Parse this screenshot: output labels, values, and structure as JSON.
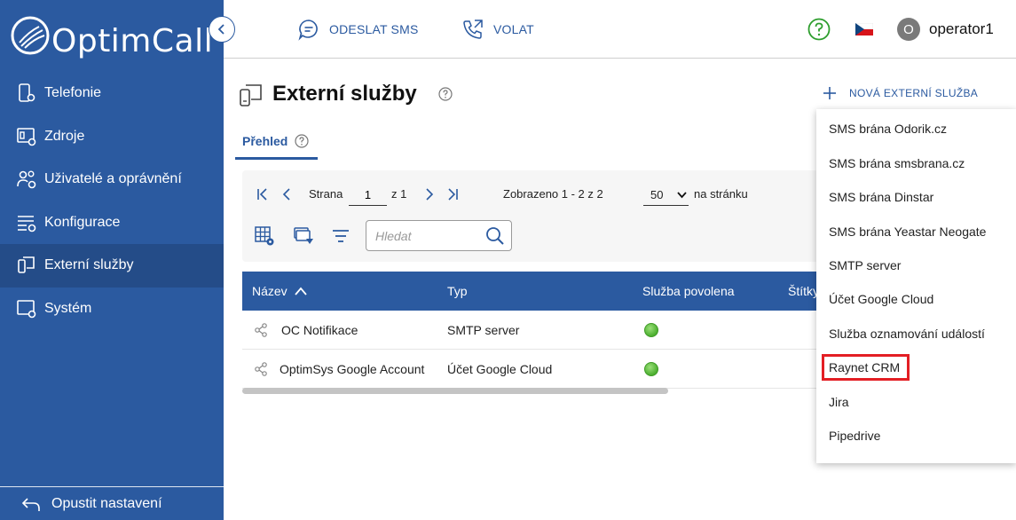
{
  "app": {
    "name": "OptimCall"
  },
  "sidebar": {
    "items": [
      {
        "label": "Telefonie",
        "icon": "phone-gear-icon"
      },
      {
        "label": "Zdroje",
        "icon": "resources-gear-icon"
      },
      {
        "label": "Uživatelé a oprávnění",
        "icon": "users-gear-icon"
      },
      {
        "label": "Konfigurace",
        "icon": "config-gear-icon"
      },
      {
        "label": "Externí služby",
        "icon": "external-services-icon"
      },
      {
        "label": "Systém",
        "icon": "system-gear-icon"
      }
    ],
    "active_index": 4,
    "bottom_label": "Opustit nastavení"
  },
  "topbar": {
    "send_sms": "ODESLAT SMS",
    "call": "VOLAT",
    "username": "operator1",
    "avatar_letter": "O"
  },
  "page": {
    "title": "Externí služby",
    "new_service_label": "NOVÁ EXTERNÍ SLUŽBA",
    "tab_label": "Přehled"
  },
  "pager": {
    "page_label": "Strana",
    "current_page": "1",
    "of_label": "z 1",
    "shown_label": "Zobrazeno 1 - 2 z 2",
    "per_page_value": "50",
    "per_page_label": "na stránku"
  },
  "search": {
    "placeholder": "Hledat"
  },
  "table": {
    "columns": [
      "Název",
      "Typ",
      "Služba povolena",
      "Štítky"
    ],
    "rows": [
      {
        "name": "OC Notifikace",
        "type": "SMTP server",
        "enabled": true
      },
      {
        "name": "OptimSys Google Account",
        "type": "Účet Google Cloud",
        "enabled": true
      }
    ]
  },
  "menu": {
    "items": [
      "SMS brána Odorik.cz",
      "SMS brána smsbrana.cz",
      "SMS brána Dinstar",
      "SMS brána Yeastar Neogate",
      "SMTP server",
      "Účet Google Cloud",
      "Služba oznamování událostí",
      "Raynet CRM",
      "Jira",
      "Pipedrive"
    ],
    "highlighted_index": 7
  },
  "colors": {
    "primary": "#2b5aa0",
    "active_nav": "#244c88",
    "highlight_border": "#e31e24",
    "status_green": "#4caf2f",
    "help_green": "#2e9e2e"
  }
}
